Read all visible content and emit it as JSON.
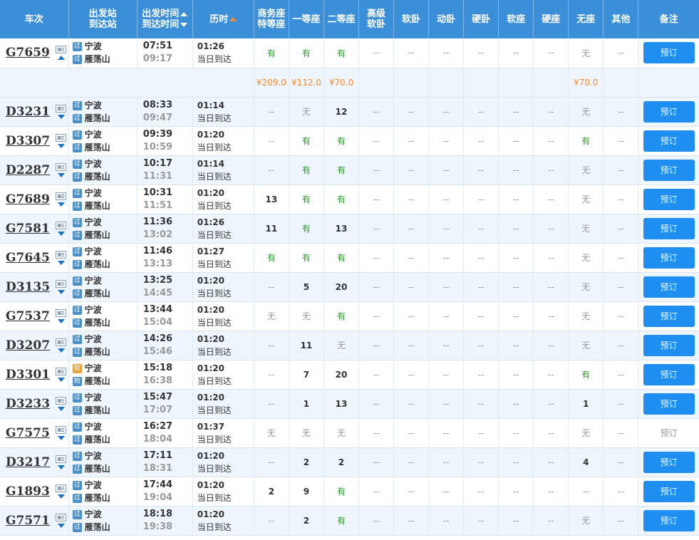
{
  "header": {
    "train": "车次",
    "station1": "出发站",
    "station2": "到达站",
    "time1": "出发时间",
    "time2": "到达时间",
    "duration": "历时",
    "seats": [
      {
        "l1": "商务座",
        "l2": "特等座"
      },
      {
        "l1": "一等座",
        "l2": ""
      },
      {
        "l1": "二等座",
        "l2": ""
      },
      {
        "l1": "高级",
        "l2": "软卧"
      },
      {
        "l1": "软卧",
        "l2": ""
      },
      {
        "l1": "动卧",
        "l2": ""
      },
      {
        "l1": "硬卧",
        "l2": ""
      },
      {
        "l1": "软座",
        "l2": ""
      },
      {
        "l1": "硬座",
        "l2": ""
      },
      {
        "l1": "无座",
        "l2": ""
      },
      {
        "l1": "其他",
        "l2": ""
      }
    ],
    "note": "备注"
  },
  "labels": {
    "pass_badge": "过",
    "start_badge": "始",
    "same_day": "当日到达",
    "book": "预订"
  },
  "colors": {
    "header_bg": "#3a8fd8",
    "button_bg": "#1e8ef0",
    "available_green": "#2a9a2a",
    "price_orange": "#fa8b30"
  },
  "price_row": [
    "¥209.0",
    "¥112.0",
    "¥70.0",
    "",
    "",
    "",
    "",
    "",
    "",
    "¥70.0",
    ""
  ],
  "trains": [
    {
      "no": "G7659",
      "expanded": true,
      "badge": "过",
      "from": "宁波",
      "to": "雁荡山",
      "dep": "07:51",
      "arr": "09:17",
      "dur": "01:26",
      "day": "当日到达",
      "seats": [
        "有",
        "有",
        "有",
        "--",
        "--",
        "--",
        "--",
        "--",
        "--",
        "无",
        "--"
      ],
      "book": "预订",
      "bookable": true
    },
    {
      "no": "D3231",
      "badge": "过",
      "from": "宁波",
      "to": "雁荡山",
      "dep": "08:33",
      "arr": "09:47",
      "dur": "01:14",
      "day": "当日到达",
      "seats": [
        "--",
        "无",
        "12",
        "--",
        "--",
        "--",
        "--",
        "--",
        "--",
        "无",
        "--"
      ],
      "book": "预订",
      "bookable": true
    },
    {
      "no": "D3307",
      "badge": "过",
      "from": "宁波",
      "to": "雁荡山",
      "dep": "09:39",
      "arr": "10:59",
      "dur": "01:20",
      "day": "当日到达",
      "seats": [
        "--",
        "有",
        "有",
        "--",
        "--",
        "--",
        "--",
        "--",
        "--",
        "有",
        "--"
      ],
      "book": "预订",
      "bookable": true
    },
    {
      "no": "D2287",
      "badge": "过",
      "from": "宁波",
      "to": "雁荡山",
      "dep": "10:17",
      "arr": "11:31",
      "dur": "01:14",
      "day": "当日到达",
      "seats": [
        "--",
        "有",
        "有",
        "--",
        "--",
        "--",
        "--",
        "--",
        "--",
        "无",
        "--"
      ],
      "book": "预订",
      "bookable": true
    },
    {
      "no": "G7689",
      "badge": "过",
      "from": "宁波",
      "to": "雁荡山",
      "dep": "10:31",
      "arr": "11:51",
      "dur": "01:20",
      "day": "当日到达",
      "seats": [
        "13",
        "有",
        "有",
        "--",
        "--",
        "--",
        "--",
        "--",
        "--",
        "无",
        "--"
      ],
      "book": "预订",
      "bookable": true
    },
    {
      "no": "G7581",
      "badge": "过",
      "from": "宁波",
      "to": "雁荡山",
      "dep": "11:36",
      "arr": "13:02",
      "dur": "01:26",
      "day": "当日到达",
      "seats": [
        "11",
        "有",
        "13",
        "--",
        "--",
        "--",
        "--",
        "--",
        "--",
        "无",
        "--"
      ],
      "book": "预订",
      "bookable": true
    },
    {
      "no": "G7645",
      "badge": "过",
      "from": "宁波",
      "to": "雁荡山",
      "dep": "11:46",
      "arr": "13:13",
      "dur": "01:27",
      "day": "当日到达",
      "seats": [
        "有",
        "有",
        "有",
        "--",
        "--",
        "--",
        "--",
        "--",
        "--",
        "无",
        "--"
      ],
      "book": "预订",
      "bookable": true
    },
    {
      "no": "D3135",
      "badge": "过",
      "from": "宁波",
      "to": "雁荡山",
      "dep": "13:25",
      "arr": "14:45",
      "dur": "01:20",
      "day": "当日到达",
      "seats": [
        "--",
        "5",
        "20",
        "--",
        "--",
        "--",
        "--",
        "--",
        "--",
        "无",
        "--"
      ],
      "book": "预订",
      "bookable": true
    },
    {
      "no": "G7537",
      "badge": "过",
      "from": "宁波",
      "to": "雁荡山",
      "dep": "13:44",
      "arr": "15:04",
      "dur": "01:20",
      "day": "当日到达",
      "seats": [
        "无",
        "无",
        "有",
        "--",
        "--",
        "--",
        "--",
        "--",
        "--",
        "无",
        "--"
      ],
      "book": "预订",
      "bookable": true
    },
    {
      "no": "D3207",
      "badge": "过",
      "from": "宁波",
      "to": "雁荡山",
      "dep": "14:26",
      "arr": "15:46",
      "dur": "01:20",
      "day": "当日到达",
      "seats": [
        "--",
        "11",
        "无",
        "--",
        "--",
        "--",
        "--",
        "--",
        "--",
        "无",
        "--"
      ],
      "book": "预订",
      "bookable": true
    },
    {
      "no": "D3301",
      "badge": "始",
      "from": "宁波",
      "to": "雁荡山",
      "dep": "15:18",
      "arr": "16:38",
      "dur": "01:20",
      "day": "当日到达",
      "seats": [
        "--",
        "7",
        "20",
        "--",
        "--",
        "--",
        "--",
        "--",
        "--",
        "有",
        "--"
      ],
      "book": "预订",
      "bookable": true
    },
    {
      "no": "D3233",
      "badge": "过",
      "from": "宁波",
      "to": "雁荡山",
      "dep": "15:47",
      "arr": "17:07",
      "dur": "01:20",
      "day": "当日到达",
      "seats": [
        "--",
        "1",
        "13",
        "--",
        "--",
        "--",
        "--",
        "--",
        "--",
        "1",
        "--"
      ],
      "book": "预订",
      "bookable": true
    },
    {
      "no": "G7575",
      "badge": "过",
      "from": "宁波",
      "to": "雁荡山",
      "dep": "16:27",
      "arr": "18:04",
      "dur": "01:37",
      "day": "当日到达",
      "seats": [
        "无",
        "无",
        "无",
        "--",
        "--",
        "--",
        "--",
        "--",
        "--",
        "无",
        "--"
      ],
      "book": "预订",
      "bookable": false
    },
    {
      "no": "D3217",
      "badge": "过",
      "from": "宁波",
      "to": "雁荡山",
      "dep": "17:11",
      "arr": "18:31",
      "dur": "01:20",
      "day": "当日到达",
      "seats": [
        "--",
        "2",
        "2",
        "--",
        "--",
        "--",
        "--",
        "--",
        "--",
        "4",
        "--"
      ],
      "book": "预订",
      "bookable": true
    },
    {
      "no": "G1893",
      "badge": "过",
      "from": "宁波",
      "to": "雁荡山",
      "dep": "17:44",
      "arr": "19:04",
      "dur": "01:20",
      "day": "当日到达",
      "seats": [
        "2",
        "9",
        "有",
        "--",
        "--",
        "--",
        "--",
        "--",
        "--",
        "--",
        "--"
      ],
      "book": "预订",
      "bookable": true
    },
    {
      "no": "G7571",
      "badge": "过",
      "from": "宁波",
      "to": "雁荡山",
      "dep": "18:18",
      "arr": "19:38",
      "dur": "01:20",
      "day": "当日到达",
      "seats": [
        "--",
        "2",
        "有",
        "--",
        "--",
        "--",
        "--",
        "--",
        "--",
        "无",
        "--"
      ],
      "book": "预订",
      "bookable": true
    }
  ]
}
